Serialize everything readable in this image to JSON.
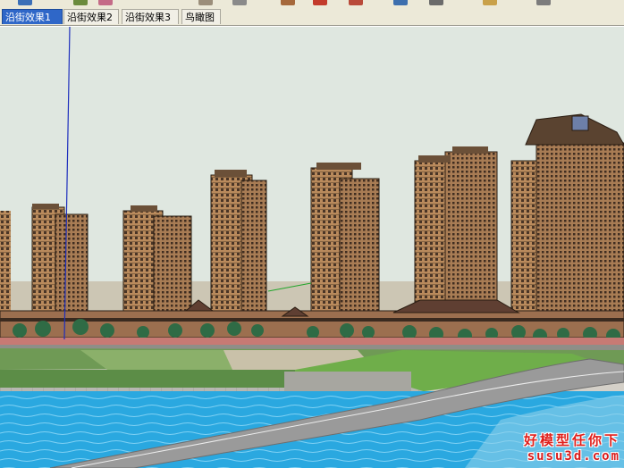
{
  "scene_tabs": [
    {
      "label": "沿街效果1",
      "active": true
    },
    {
      "label": "沿街效果2",
      "active": false
    },
    {
      "label": "沿街效果3",
      "active": false
    },
    {
      "label": "鸟瞰图",
      "active": false
    }
  ],
  "toolbar_icons": [
    "select-tool-icon",
    "paint-bucket-icon",
    "eraser-icon",
    "rectangle-tool-icon",
    "line-tool-icon",
    "push-pull-icon",
    "move-tool-icon",
    "rotate-tool-icon",
    "tape-measure-icon",
    "orbit-icon",
    "pan-icon",
    "zoom-icon"
  ],
  "watermark": {
    "line1": "好模型任你下",
    "line2": "susu3d.com"
  },
  "colors": {
    "active_tab": "#2f67c8",
    "sky": "#dfe7e0",
    "water": "#2aa8e0",
    "building": "#b98a5c",
    "watermark": "#e0201c"
  }
}
